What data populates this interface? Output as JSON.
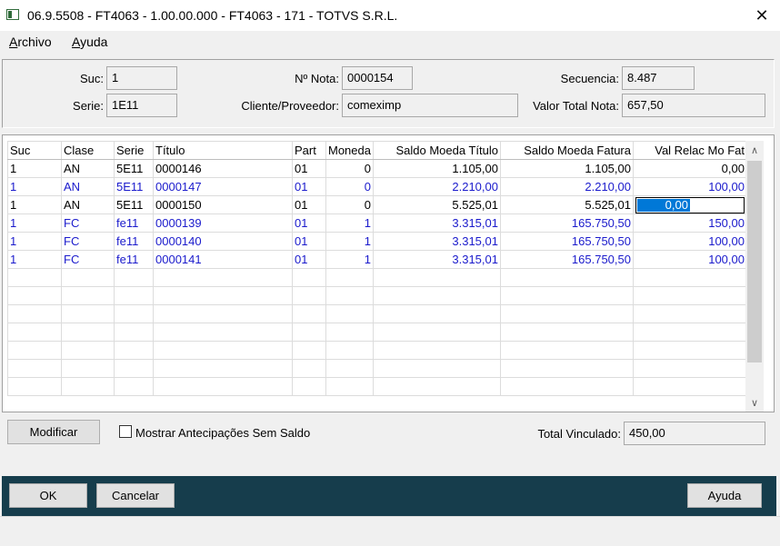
{
  "window": {
    "title": "06.9.5508 - FT4063 - 1.00.00.000 - FT4063 - 171 - TOTVS S.R.L.",
    "close_glyph": "✕"
  },
  "menu": {
    "archivo": {
      "mnemonic": "A",
      "rest": "rchivo"
    },
    "ayuda": {
      "mnemonic": "A",
      "rest": "yuda"
    }
  },
  "header": {
    "suc_label": "Suc:",
    "suc_value": "1",
    "serie_label": "Serie:",
    "serie_value": "1E11",
    "nota_label": "Nº Nota:",
    "nota_value": "0000154",
    "cliente_label": "Cliente/Proveedor:",
    "cliente_value": "comeximp",
    "secuencia_label": "Secuencia:",
    "secuencia_value": "8.487",
    "valor_label": "Valor Total Nota:",
    "valor_value": "657,50"
  },
  "grid": {
    "columns": [
      "Suc",
      "Clase",
      "Serie",
      "Título",
      "Part",
      "Moneda",
      "Saldo Moeda Título",
      "Saldo Moeda Fatura",
      "Val Relac Mo Fat"
    ],
    "rows": [
      [
        "1",
        "AN",
        "5E11",
        "0000146",
        "01",
        "0",
        "1.105,00",
        "1.105,00",
        "0,00"
      ],
      [
        "1",
        "AN",
        "5E11",
        "0000147",
        "01",
        "0",
        "2.210,00",
        "2.210,00",
        "100,00"
      ],
      [
        "1",
        "AN",
        "5E11",
        "0000150",
        "01",
        "0",
        "5.525,01",
        "5.525,01",
        "0,00"
      ],
      [
        "1",
        "FC",
        "fe11",
        "0000139",
        "01",
        "1",
        "3.315,01",
        "165.750,50",
        "150,00"
      ],
      [
        "1",
        "FC",
        "fe11",
        "0000140",
        "01",
        "1",
        "3.315,01",
        "165.750,50",
        "100,00"
      ],
      [
        "1",
        "FC",
        "fe11",
        "0000141",
        "01",
        "1",
        "3.315,01",
        "165.750,50",
        "100,00"
      ]
    ],
    "row_colors": [
      "#000000",
      "#1a1acc",
      "#000000",
      "#1a1acc",
      "#1a1acc",
      "#1a1acc"
    ],
    "scroll_up_glyph": "∧",
    "scroll_down_glyph": "∨"
  },
  "actions": {
    "modificar_label": "Modificar",
    "checkbox_label": "Mostrar Antecipações Sem Saldo",
    "checkbox_checked": false,
    "total_label": "Total Vinculado:",
    "total_value": "450,00"
  },
  "footer": {
    "ok_label": "OK",
    "cancelar_label": "Cancelar",
    "ayuda_label": "Ayuda",
    "bar_color": "#163d4c"
  }
}
